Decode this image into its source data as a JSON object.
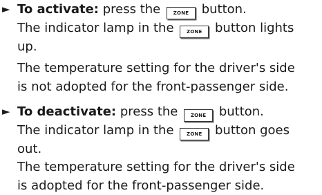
{
  "activate": {
    "arrow": "►",
    "label": "To activate:",
    "line1_a": " press the",
    "line1_b": " button.",
    "line2_a": "The indicator lamp in the",
    "line2_b": " button lights",
    "line3": "up.",
    "note_line1": "The temperature setting for the driver's side",
    "note_line2": "is not adopted for the front-passenger side."
  },
  "deactivate": {
    "arrow": "►",
    "label": "To deactivate:",
    "line1_a": " press the",
    "line1_b": " button.",
    "line2_a": "The indicator lamp in the",
    "line2_b": " button goes",
    "line3": "out.",
    "note_line1": "The temperature setting for the driver's side",
    "note_line2": "is adopted for the front-passenger side."
  },
  "key_label": "ZONE"
}
